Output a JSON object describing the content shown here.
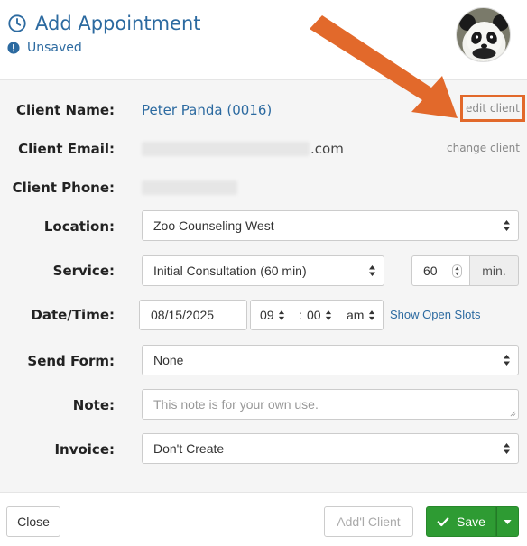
{
  "header": {
    "title": "Add Appointment",
    "status": "Unsaved",
    "avatar": "panda"
  },
  "client": {
    "name_label": "Client Name:",
    "name_value": "Peter Panda (0016)",
    "edit_link": "edit client",
    "email_label": "Client Email:",
    "email_suffix": ".com",
    "change_link": "change client",
    "phone_label": "Client Phone:"
  },
  "form": {
    "location_label": "Location:",
    "location_value": "Zoo Counseling West",
    "service_label": "Service:",
    "service_value": "Initial Consultation (60 min)",
    "duration_value": "60",
    "duration_unit": "min.",
    "datetime_label": "Date/Time:",
    "date_value": "08/15/2025",
    "hour_value": "09",
    "time_sep": ":",
    "minute_value": "00",
    "ampm_value": "am",
    "show_slots": "Show Open Slots",
    "send_form_label": "Send Form:",
    "send_form_value": "None",
    "note_label": "Note:",
    "note_placeholder": "This note is for your own use.",
    "invoice_label": "Invoice:",
    "invoice_value": "Don't Create"
  },
  "footer": {
    "close": "Close",
    "add_client": "Add'l Client",
    "save": "Save"
  },
  "colors": {
    "accent": "#2c6aa0",
    "highlight": "#e2692b",
    "save": "#2e9b33"
  }
}
